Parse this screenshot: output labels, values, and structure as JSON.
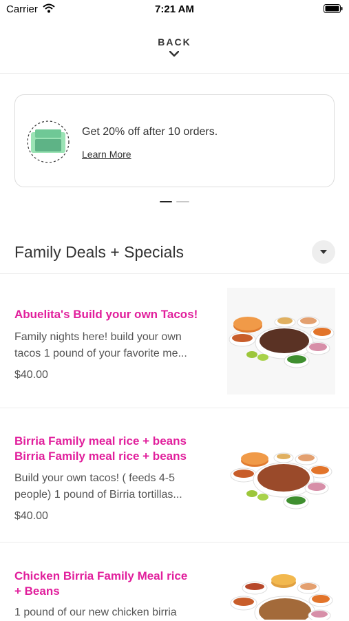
{
  "status_bar": {
    "carrier": "Carrier",
    "time": "7:21 AM"
  },
  "nav": {
    "back_label": "BACK"
  },
  "promo": {
    "text": "Get 20% off after 10 orders.",
    "link": "Learn More"
  },
  "section": {
    "title": "Family Deals + Specials"
  },
  "items": [
    {
      "title": "Abuelita's Build your own Tacos!",
      "desc1": "Family nights here! build your own",
      "desc2": "tacos 1 pound of your favorite me...",
      "price": "$40.00"
    },
    {
      "title1": "Birria Family meal rice + beans",
      "title2": "Birria Family meal rice + beans",
      "desc1": "Build your own tacos! ( feeds 4-5",
      "desc2": "people) 1 pound of Birria tortillas...",
      "price": "$40.00"
    },
    {
      "title1": "Chicken Birria Family Meal rice",
      "title2": "+ Beans",
      "desc1": "1 pound of our new chicken birria"
    }
  ],
  "colors": {
    "accent": "#e11f9c",
    "text": "#333333"
  }
}
